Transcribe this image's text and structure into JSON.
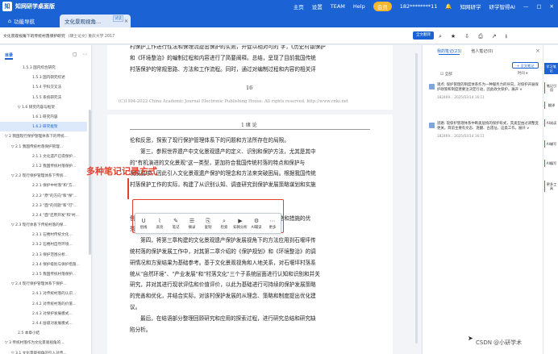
{
  "titlebar": {
    "logo_text": "知",
    "app_title": "知网研学桌面版",
    "user": "182********11",
    "vip": "会员",
    "menu": [
      "主页",
      "设置",
      "TEAM",
      "Help"
    ],
    "right_items": [
      "知网研学",
      "研学智得AI"
    ]
  },
  "tabs": [
    {
      "label": "功能导航"
    },
    {
      "label": "文化景观视角...",
      "badge": "试读",
      "close": "×"
    }
  ],
  "infobar": {
    "doc_title": "文化景观视角下的传统村落保护研究",
    "meta": "(硕士论文)  重庆大学  2017",
    "button_label": "全文翻译",
    "icons": [
      "⌕",
      "★",
      "⇩",
      "⎙",
      "↗",
      "⭳"
    ]
  },
  "sidebar": {
    "tab": "目录",
    "ctrl": [
      "▢",
      "⋯"
    ],
    "toc": [
      {
        "label": "1.5.3 国内综合研究",
        "indent": 28
      },
      {
        "label": "1.5.3 国内研究综述",
        "indent": 40
      },
      {
        "label": "1.5.4 学科交叉法",
        "indent": 40
      },
      {
        "label": "1.5.5 系统研究法",
        "indent": 40
      },
      {
        "label": "▽ 1.6 研究内容与框架",
        "indent": 22
      },
      {
        "label": "1.6.1 研究内容",
        "indent": 40
      },
      {
        "label": "1.6.2 研究框架",
        "indent": 40,
        "active": true
      },
      {
        "label": "▽ 2 我国现行保护管理体系下的传统...",
        "indent": 6
      },
      {
        "label": "▽ 2.1 我国传统村落保护管理...",
        "indent": 14
      },
      {
        "label": "2.1.1 文化遗产已得保护...",
        "indent": 40
      },
      {
        "label": "2.1.2 我国传统村落保护...",
        "indent": 40
      },
      {
        "label": "▽ 2.2 现行保护管理体系下传统...",
        "indent": 14
      },
      {
        "label": "2.2.1 保护中村落\"和\"方...",
        "indent": 40
      },
      {
        "label": "2.2.2 \"原\"的方向\"和\"保\"...",
        "indent": 40
      },
      {
        "label": "2.2.3 \"面\"的问题\"和\"可\"...",
        "indent": 40
      },
      {
        "label": "2.2.4 \"面\"还原开发\"和\"村...",
        "indent": 40
      },
      {
        "label": "▽ 2.3 现行体系下传统村落的保...",
        "indent": 14
      },
      {
        "label": "2.3.1 石楼村传统文化...",
        "indent": 40
      },
      {
        "label": "2.3.2 石楼村自然环境...",
        "indent": 40
      },
      {
        "label": "2.3.3 保护范围分析...",
        "indent": 40
      },
      {
        "label": "2.3.4 保护级别与保护措施...",
        "indent": 40
      },
      {
        "label": "2.3.5 我国传统村落保护...",
        "indent": 40
      },
      {
        "label": "▽ 2.4 现行保护管理体系下保护...",
        "indent": 14
      },
      {
        "label": "2.4.1 对传统村落的认识...",
        "indent": 40
      },
      {
        "label": "2.4.2 对传统村落的价值...",
        "indent": 40
      },
      {
        "label": "2.4.3 对保护发展模式...",
        "indent": 40
      },
      {
        "label": "2.4.4 层级对发展模式...",
        "indent": 40
      },
      {
        "label": "2.5 本章小结",
        "indent": 22
      },
      {
        "label": "▽ 3 传统村落作为文化景观视角的...",
        "indent": 6
      },
      {
        "label": "▽ 3.1 文化景观视角的引入对传...",
        "indent": 14
      },
      {
        "label": "3.1.1 有利于保护工作...",
        "indent": 40
      }
    ]
  },
  "document": {
    "page1_lines": [
      "村保护工作进行性法和保理流提出保护的实则，开促以相对可的 字，《历史村镇保护",
      "和《环境整治》的编制过程和内容进行了简要阐释。总结，呈现了目前我国传统",
      "村落保护的常规思路、方法和工作流程。同时，通过对编制过程和内容的相关评"
    ],
    "page_number": "16",
    "copyright": "(C)1994-2022 China Academic Journal Electronic Publishing House. All rights reserved.   http://www.cnki.net",
    "running_header": "1 绪 论",
    "page2_lines": [
      "伦和反思，探索了现行保护管理体系下的问题和方法所存在的局限。",
      "第三，参照世界遗产中文化景观遗产的定义、识别和保护方法，尤其是其中",
      "的\"有机演进的文化景观\"这一类型，更加符合我国传统村落的特点和保护与",
      "发展要求，因此引入文化景观遗产保护的理念和方法来突破困局。根据我国传统",
      "村落保护工作的实际，构建了从识别认知、调查研究到保护发展策略谋划和实施",
      "",
      " ",
      "例分析，找到其保护发展过程中遇到的问题，借鉴其保护方法策略和措施的优",
      "秀经验。",
      "第四，将第三章构建的文化景观遗产保护发展视角下的方法应用到石堰坪传",
      "统村落的保护发展工作中，对其第二章介绍的《保护规划》和《环境整治》的调",
      "研情况和方案结果为基础参考。基于文化景观视角和人地关系，对石堰坪村落系",
      "统从\"自然环境\"、\"产业发展\"和\"村落文化\"三个子系统层面进行认知和识别和并关",
      "研究，并对其进行现状评估和价值评价，以此为基础进行可持续的保护发展策略",
      "的完善和优化，并结合实际，对该村保护发展的从理念、策略和制度提出优化建",
      "议。",
      "最后，在结语部分整理回顾研究和应用的探索过程，进行研究总结和研究缺",
      "陷分析。"
    ],
    "highlight_word": "找到其"
  },
  "annotation": {
    "label": "多种笔记记录方式"
  },
  "toolbar": [
    {
      "icon": "U",
      "label": "划线"
    },
    {
      "icon": "⌇",
      "label": "高亮"
    },
    {
      "icon": "✎",
      "label": "笔记"
    },
    {
      "icon": "☰",
      "label": "摘录"
    },
    {
      "icon": "⎘",
      "label": "复制"
    },
    {
      "icon": "⌕",
      "label": "检索"
    },
    {
      "icon": "▶",
      "label": "知网分析"
    },
    {
      "icon": "⚙",
      "label": "AI辅读"
    },
    {
      "icon": "⋯",
      "label": "更多"
    }
  ],
  "rightpanel": {
    "tabs": [
      "我的笔记(23)",
      "他人笔记(0)"
    ],
    "add_button": "+ 全文笔记",
    "filter_all": "☑ 全部",
    "sort": "时间 ▾",
    "notes": [
      {
        "text": "观点: 保护管理的制度体系作为一种服务力的导向，对保护开展保护政策和制度建要注决定行动，因此政文保护。展开 ∨",
        "meta": "182469...   2025/03/14 16:11"
      },
      {
        "text": "思路: 现保护管理体系中断类层统的保护形式，其类型由过调整变更关，目前主要有文态、逐翻、古遗址，这类工作。展开 ∨",
        "meta": "182469...   2025/03/14 16:11"
      }
    ]
  },
  "rail": [
    {
      "label": "学习笔记",
      "active": true
    },
    {
      "label": "笔记引用"
    },
    {
      "label": "翻译"
    },
    {
      "label": "AI阅读"
    },
    {
      "label": "AI辅写"
    },
    {
      "label": "AI编写"
    },
    {
      "label": "更多工具"
    }
  ],
  "watermark": "CSDN @小研学术",
  "colors": {
    "brand": "#1b63d4",
    "annotation": "#e3402d"
  }
}
